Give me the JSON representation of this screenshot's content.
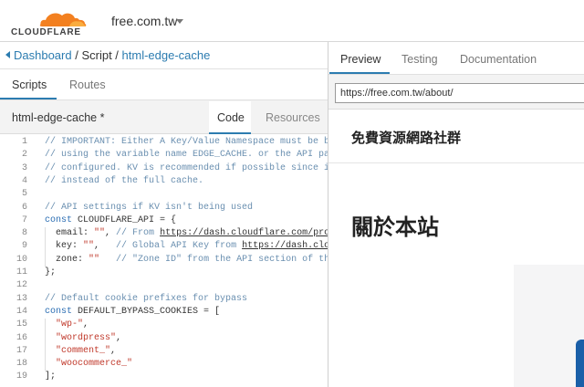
{
  "header": {
    "logo_text": "CLOUDFLARE",
    "domain": "free.com.tw",
    "brand_color": "#f38020"
  },
  "breadcrumb": {
    "dashboard": "Dashboard",
    "sep1": " / ",
    "script": "Script",
    "sep2": " / ",
    "current": "html-edge-cache"
  },
  "left_tabs": {
    "scripts": "Scripts",
    "routes": "Routes"
  },
  "editor": {
    "filename": "html-edge-cache *",
    "tab_code": "Code",
    "tab_resources": "Resources"
  },
  "code_lines": [
    {
      "n": "1",
      "parts": [
        [
          "c",
          "// IMPORTANT: Either A Key/Value Namespace must be bou"
        ]
      ]
    },
    {
      "n": "2",
      "parts": [
        [
          "c",
          "// using the variable name EDGE_CACHE. or the API para"
        ]
      ]
    },
    {
      "n": "3",
      "parts": [
        [
          "c",
          "// configured. KV is recommended if possible since it"
        ]
      ]
    },
    {
      "n": "4",
      "parts": [
        [
          "c",
          "// instead of the full cache."
        ]
      ]
    },
    {
      "n": "5",
      "parts": [
        [
          "t",
          ""
        ]
      ]
    },
    {
      "n": "6",
      "parts": [
        [
          "c",
          "// API settings if KV isn't being used"
        ]
      ]
    },
    {
      "n": "7",
      "parts": [
        [
          "k",
          "const"
        ],
        [
          "t",
          " CLOUDFLARE_API = {"
        ]
      ]
    },
    {
      "n": "8",
      "parts": [
        [
          "t",
          "  email: "
        ],
        [
          "s",
          "\"\""
        ],
        [
          "t",
          ", "
        ],
        [
          "c",
          "// From "
        ],
        [
          "u",
          "https://dash.cloudflare.com/profi"
        ]
      ]
    },
    {
      "n": "9",
      "parts": [
        [
          "t",
          "  key: "
        ],
        [
          "s",
          "\"\""
        ],
        [
          "t",
          ",   "
        ],
        [
          "c",
          "// Global API Key from "
        ],
        [
          "u",
          "https://dash.cloud"
        ]
      ]
    },
    {
      "n": "10",
      "parts": [
        [
          "t",
          "  zone: "
        ],
        [
          "s",
          "\"\""
        ],
        [
          "t",
          "   "
        ],
        [
          "c",
          "// \"Zone ID\" from the API section of the"
        ]
      ]
    },
    {
      "n": "11",
      "parts": [
        [
          "t",
          "};"
        ]
      ]
    },
    {
      "n": "12",
      "parts": [
        [
          "t",
          ""
        ]
      ]
    },
    {
      "n": "13",
      "parts": [
        [
          "c",
          "// Default cookie prefixes for bypass"
        ]
      ]
    },
    {
      "n": "14",
      "parts": [
        [
          "k",
          "const"
        ],
        [
          "t",
          " DEFAULT_BYPASS_COOKIES = ["
        ]
      ]
    },
    {
      "n": "15",
      "parts": [
        [
          "t",
          "  "
        ],
        [
          "s",
          "\"wp-\""
        ],
        [
          "t",
          ","
        ]
      ]
    },
    {
      "n": "16",
      "parts": [
        [
          "t",
          "  "
        ],
        [
          "s",
          "\"wordpress\""
        ],
        [
          "t",
          ","
        ]
      ]
    },
    {
      "n": "17",
      "parts": [
        [
          "t",
          "  "
        ],
        [
          "s",
          "\"comment_\""
        ],
        [
          "t",
          ","
        ]
      ]
    },
    {
      "n": "18",
      "parts": [
        [
          "t",
          "  "
        ],
        [
          "s",
          "\"woocommerce_\""
        ]
      ]
    },
    {
      "n": "19",
      "parts": [
        [
          "t",
          "];"
        ]
      ]
    }
  ],
  "right_tabs": {
    "preview": "Preview",
    "testing": "Testing",
    "documentation": "Documentation"
  },
  "preview": {
    "url": "https://free.com.tw/about/",
    "site_title": "免費資源網路社群",
    "page_heading": "關於本站"
  }
}
